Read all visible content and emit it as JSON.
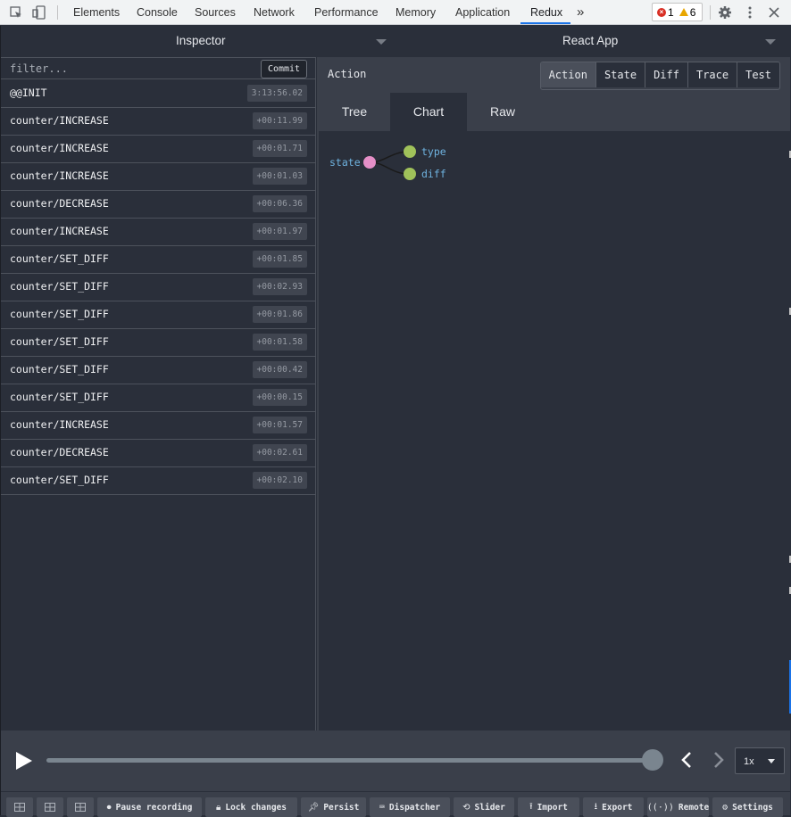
{
  "devtools": {
    "tabs": [
      "Elements",
      "Console",
      "Sources",
      "Network",
      "Performance",
      "Memory",
      "Application",
      "Redux"
    ],
    "active_tab": "Redux",
    "more_label": "»",
    "error_count": "1",
    "warning_count": "6"
  },
  "header": {
    "left_select": "Inspector",
    "right_select": "React App"
  },
  "filter": {
    "placeholder": "filter...",
    "commit_label": "Commit"
  },
  "actions": [
    {
      "name": "@@INIT",
      "time": "3:13:56.02"
    },
    {
      "name": "counter/INCREASE",
      "time": "+00:11.99"
    },
    {
      "name": "counter/INCREASE",
      "time": "+00:01.71"
    },
    {
      "name": "counter/INCREASE",
      "time": "+00:01.03"
    },
    {
      "name": "counter/DECREASE",
      "time": "+00:06.36"
    },
    {
      "name": "counter/INCREASE",
      "time": "+00:01.97"
    },
    {
      "name": "counter/SET_DIFF",
      "time": "+00:01.85"
    },
    {
      "name": "counter/SET_DIFF",
      "time": "+00:02.93"
    },
    {
      "name": "counter/SET_DIFF",
      "time": "+00:01.86"
    },
    {
      "name": "counter/SET_DIFF",
      "time": "+00:01.58"
    },
    {
      "name": "counter/SET_DIFF",
      "time": "+00:00.42"
    },
    {
      "name": "counter/SET_DIFF",
      "time": "+00:00.15"
    },
    {
      "name": "counter/INCREASE",
      "time": "+00:01.57"
    },
    {
      "name": "counter/DECREASE",
      "time": "+00:02.61"
    },
    {
      "name": "counter/SET_DIFF",
      "time": "+00:02.10"
    }
  ],
  "panel": {
    "title": "Action",
    "modes": [
      "Action",
      "State",
      "Diff",
      "Trace",
      "Test"
    ],
    "active_mode": "Action",
    "subtabs": [
      "Tree",
      "Chart",
      "Raw"
    ],
    "active_subtab": "Chart"
  },
  "tree": {
    "root": "state",
    "children": [
      "type",
      "diff"
    ],
    "colors": {
      "root": "#e58fc7",
      "leaf": "#a0c25a",
      "text": "#6fb3e0"
    }
  },
  "slider": {
    "speed": "1x"
  },
  "toolbar": {
    "pause_label": "Pause recording",
    "lock_label": "Lock changes",
    "persist_label": "Persist",
    "dispatcher_label": "Dispatcher",
    "slider_label": "Slider",
    "import_label": "Import",
    "export_label": "Export",
    "remote_label": "Remote",
    "settings_label": "Settings"
  }
}
